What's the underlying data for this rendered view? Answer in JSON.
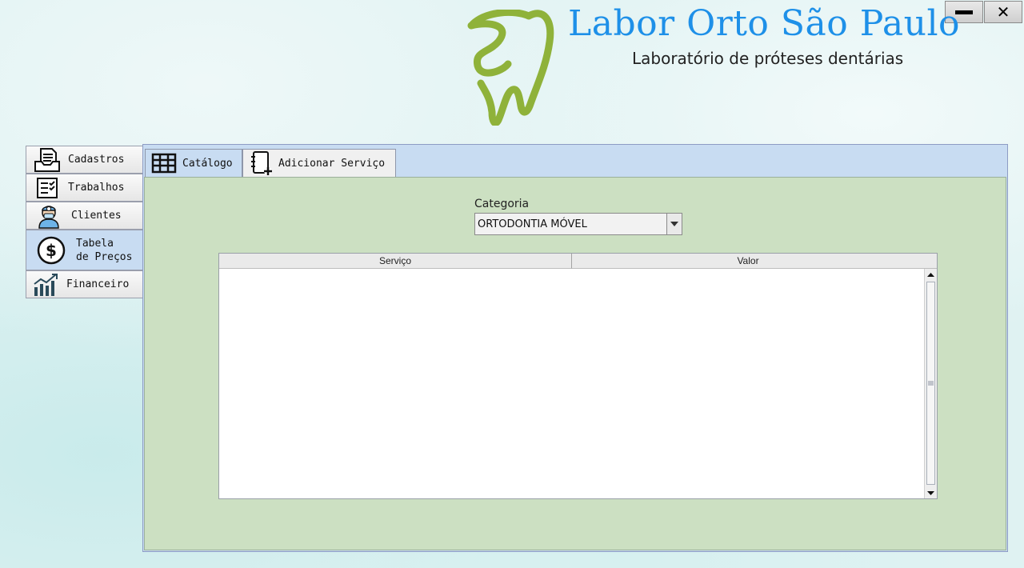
{
  "window": {
    "minimize_icon": "minimize-icon",
    "close_icon": "close-icon",
    "close_glyph": "✕"
  },
  "header": {
    "title": "Labor Orto São Paulo",
    "subtitle": "Laboratório de próteses dentárias",
    "logo_icon": "tooth-logo-icon",
    "logo_color": "#8fb23a",
    "title_color": "#1e90e8"
  },
  "sidebar": {
    "items": [
      {
        "label": "Cadastros",
        "icon": "document-tray-icon"
      },
      {
        "label": "Trabalhos",
        "icon": "checklist-icon"
      },
      {
        "label": "Clientes",
        "icon": "dentist-avatar-icon"
      },
      {
        "label_line1": "Tabela",
        "label_line2": "de Preços",
        "icon": "dollar-circle-icon",
        "active": true
      },
      {
        "label": "Financeiro",
        "icon": "growth-chart-icon"
      }
    ]
  },
  "tabs": [
    {
      "label": "Catálogo",
      "icon": "table-grid-icon",
      "active": true
    },
    {
      "label": "Adicionar Serviço",
      "icon": "notebook-add-icon",
      "active": false
    }
  ],
  "category": {
    "label": "Categoria",
    "selected": "ORTODONTIA MÓVEL"
  },
  "table": {
    "columns": [
      "Serviço",
      "Valor"
    ],
    "rows": []
  },
  "colors": {
    "panel_blue": "#c8dcf2",
    "content_green": "#cce0c2"
  }
}
